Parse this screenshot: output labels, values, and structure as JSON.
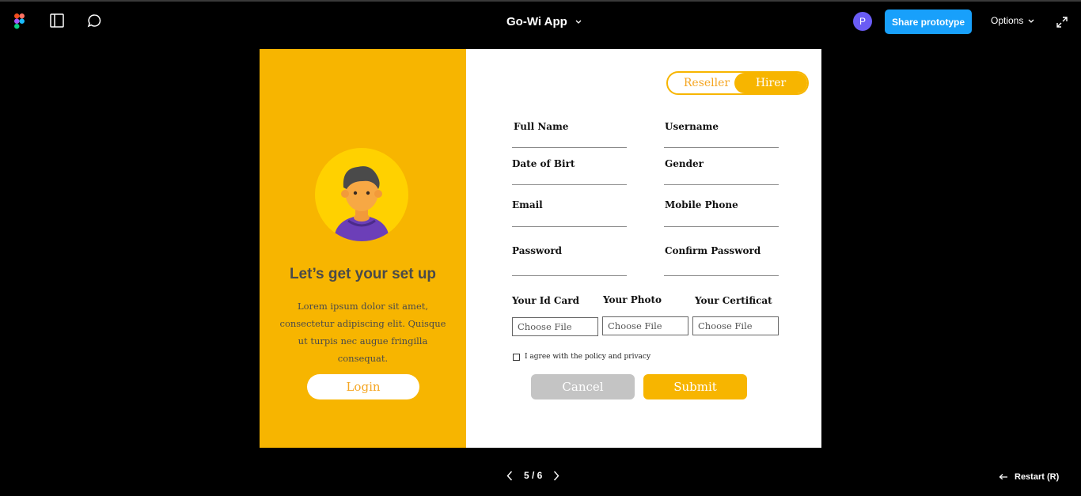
{
  "app": {
    "title": "Go-Wi App",
    "share_label": "Share prototype",
    "options_label": "Options",
    "user_initial": "P",
    "accent_color": "#18a0fb"
  },
  "left_panel": {
    "title": "Let’s get your set up",
    "description": "Lorem ipsum dolor sit amet, consectetur adipiscing elit. Quisque ut turpis nec augue fringilla consequat.",
    "login_label": "Login",
    "panel_color": "#f7b500"
  },
  "toggle": {
    "options": [
      "Reseller",
      "Hirer"
    ],
    "selected": "Hirer"
  },
  "form": {
    "full_name": "Full Name",
    "username": "Username",
    "dob": "Date of Birt",
    "gender": "Gender",
    "email": "Email",
    "mobile": "Mobile Phone",
    "password": "Password",
    "confirm_password": "Confirm Password",
    "id_card": "Your Id Card",
    "photo": "Your Photo",
    "certificate": "Your Certificat",
    "choose_file": "Choose File",
    "agree_text": "I agree with the policy and privacy",
    "cancel_label": "Cancel",
    "submit_label": "Submit"
  },
  "footer": {
    "page_indicator": "5 / 6",
    "restart_label": "Restart (R)"
  }
}
